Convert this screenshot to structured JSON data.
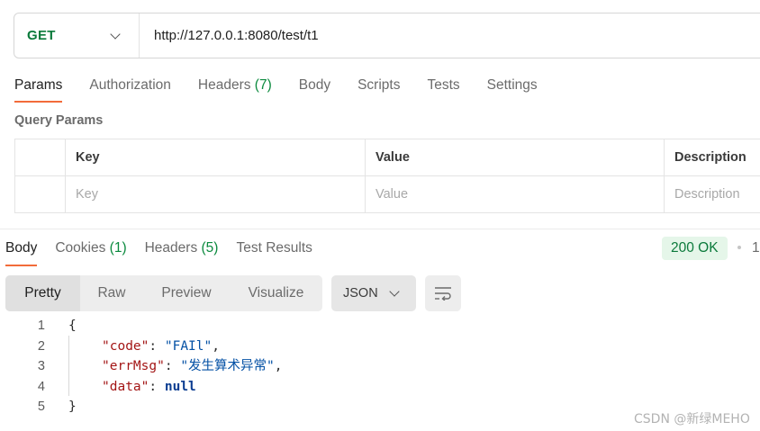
{
  "request": {
    "method": "GET",
    "url": "http://127.0.0.1:8080/test/t1"
  },
  "request_tabs": [
    {
      "label": "Params",
      "count": ""
    },
    {
      "label": "Authorization",
      "count": ""
    },
    {
      "label": "Headers",
      "count": "(7)"
    },
    {
      "label": "Body",
      "count": ""
    },
    {
      "label": "Scripts",
      "count": ""
    },
    {
      "label": "Tests",
      "count": ""
    },
    {
      "label": "Settings",
      "count": ""
    }
  ],
  "query_params": {
    "title": "Query Params",
    "headers": [
      "Key",
      "Value",
      "Description"
    ],
    "placeholders": [
      "Key",
      "Value",
      "Description"
    ]
  },
  "response_tabs": [
    {
      "label": "Body",
      "count": ""
    },
    {
      "label": "Cookies",
      "count": "(1)"
    },
    {
      "label": "Headers",
      "count": "(5)"
    },
    {
      "label": "Test Results",
      "count": ""
    }
  ],
  "status": {
    "text": "200 OK",
    "time_partial": "1"
  },
  "view_modes": [
    "Pretty",
    "Raw",
    "Preview",
    "Visualize"
  ],
  "format": "JSON",
  "code_lines": [
    {
      "num": "1",
      "open": "{"
    },
    {
      "num": "2",
      "key": "\"code\"",
      "sep": ": ",
      "value": "\"FAIl\"",
      "tail": ","
    },
    {
      "num": "3",
      "key": "\"errMsg\"",
      "sep": ": ",
      "value": "\"发生算术异常\"",
      "tail": ","
    },
    {
      "num": "4",
      "key": "\"data\"",
      "sep": ": ",
      "value": "null",
      "tail": ""
    },
    {
      "num": "5",
      "close": "}"
    }
  ],
  "watermark": "CSDN @新绿MEHO",
  "colors": {
    "accent": "#f26b3a",
    "method_green": "#0b7a3b",
    "status_bg": "#e5f6e9"
  }
}
